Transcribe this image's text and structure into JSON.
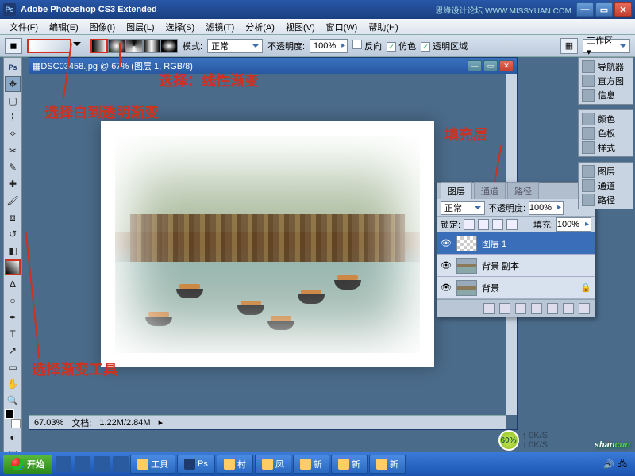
{
  "app": {
    "title": "Adobe Photoshop CS3 Extended",
    "watermark": "思缘设计论坛 WWW.MISSYUAN.COM"
  },
  "menu": {
    "items": [
      "文件(F)",
      "编辑(E)",
      "图像(I)",
      "图层(L)",
      "选择(S)",
      "滤镜(T)",
      "分析(A)",
      "视图(V)",
      "窗口(W)",
      "帮助(H)"
    ]
  },
  "optionbar": {
    "mode_label": "模式:",
    "mode_value": "正常",
    "opacity_label": "不透明度:",
    "opacity_value": "100%",
    "reverse": "反向",
    "dither": "仿色",
    "transparency": "透明区域",
    "workspace_label": "工作区 ▾"
  },
  "doc": {
    "title": "DSC03458.jpg @ 67% (图层 1, RGB/8)",
    "zoom": "67.03%",
    "filesize_label": "文档:",
    "filesize": "1.22M/2.84M"
  },
  "right_panels": {
    "nav": "导航器",
    "histogram": "直方图",
    "info": "信息",
    "color": "颜色",
    "swatches": "色板",
    "styles": "样式",
    "layers": "图层",
    "channels": "通道",
    "paths": "路径"
  },
  "layers_panel": {
    "tabs": [
      "图层",
      "通道",
      "路径"
    ],
    "blend_mode": "正常",
    "opacity_label": "不透明度:",
    "opacity": "100%",
    "lock_label": "锁定:",
    "fill_label": "填充:",
    "fill": "100%",
    "items": [
      {
        "name": "图层 1",
        "visible": true,
        "selected": true,
        "thumb": "checker"
      },
      {
        "name": "背景 副本",
        "visible": true,
        "selected": false,
        "thumb": "img"
      },
      {
        "name": "背景",
        "visible": true,
        "selected": false,
        "thumb": "img",
        "locked": true
      }
    ]
  },
  "annotations": {
    "linear_gradient": "选择：线性渐变",
    "white_to_transparent": "选择白到透明渐变",
    "fill_layer": "填充层",
    "gradient_tool": "选择渐变工具"
  },
  "taskbar": {
    "start": "开始",
    "items": [
      "工具",
      "村",
      "凤",
      "新",
      "新",
      "新"
    ]
  },
  "badge": {
    "pct": "60%",
    "speed1": "0K/S",
    "speed2": "0K/S"
  },
  "watermark2": {
    "a": "shan",
    "b": "cun"
  }
}
